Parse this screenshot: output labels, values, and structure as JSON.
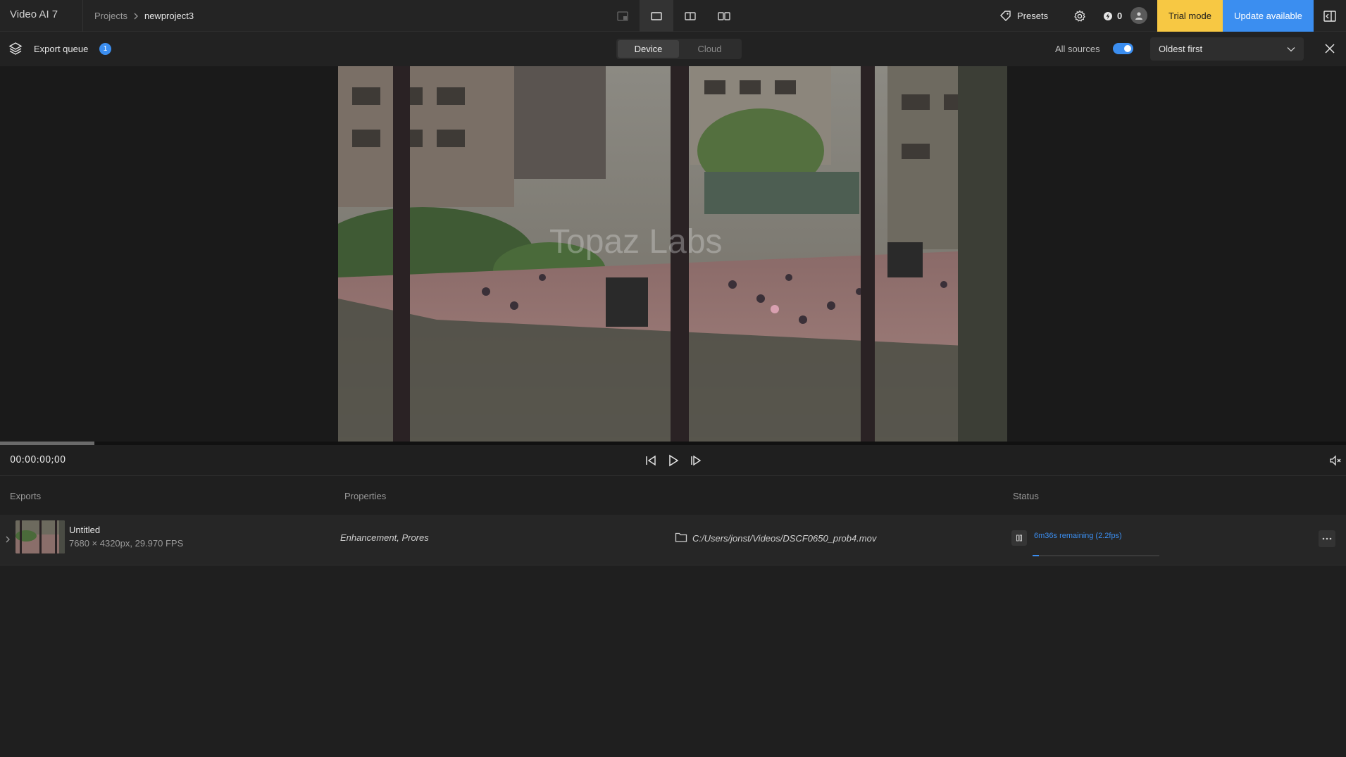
{
  "app": {
    "title": "Video AI 7"
  },
  "breadcrumb": {
    "root": "Projects",
    "current": "newproject3"
  },
  "header": {
    "view_modes": [
      "single-view-icon",
      "original-view-icon",
      "split-view-icon",
      "side-by-side-icon"
    ],
    "presets_label": "Presets",
    "credits": "0",
    "trial_label": "Trial mode",
    "update_label": "Update available"
  },
  "queue": {
    "label": "Export queue",
    "count": "1",
    "segments": [
      "Device",
      "Cloud"
    ],
    "active_segment": "Device",
    "all_sources_label": "All sources",
    "all_sources_on": true,
    "sort": "Oldest first"
  },
  "player": {
    "timecode": "00:00:00;00",
    "scrub_progress": 0.07,
    "watermark": "Topaz Labs"
  },
  "table": {
    "headers": {
      "exports": "Exports",
      "properties": "Properties",
      "status": "Status"
    },
    "rows": [
      {
        "name": "Untitled",
        "meta": "7680 × 4320px, 29.970 FPS",
        "properties": "Enhancement, Prores",
        "path": "C:/Users/jonst/Videos/DSCF0650_prob4.mov",
        "status": "6m36s remaining (2.2fps)",
        "progress": 0.05
      }
    ]
  },
  "colors": {
    "accent": "#3b8ef0",
    "trial": "#f7c843",
    "bg": "#1f1f1f"
  }
}
